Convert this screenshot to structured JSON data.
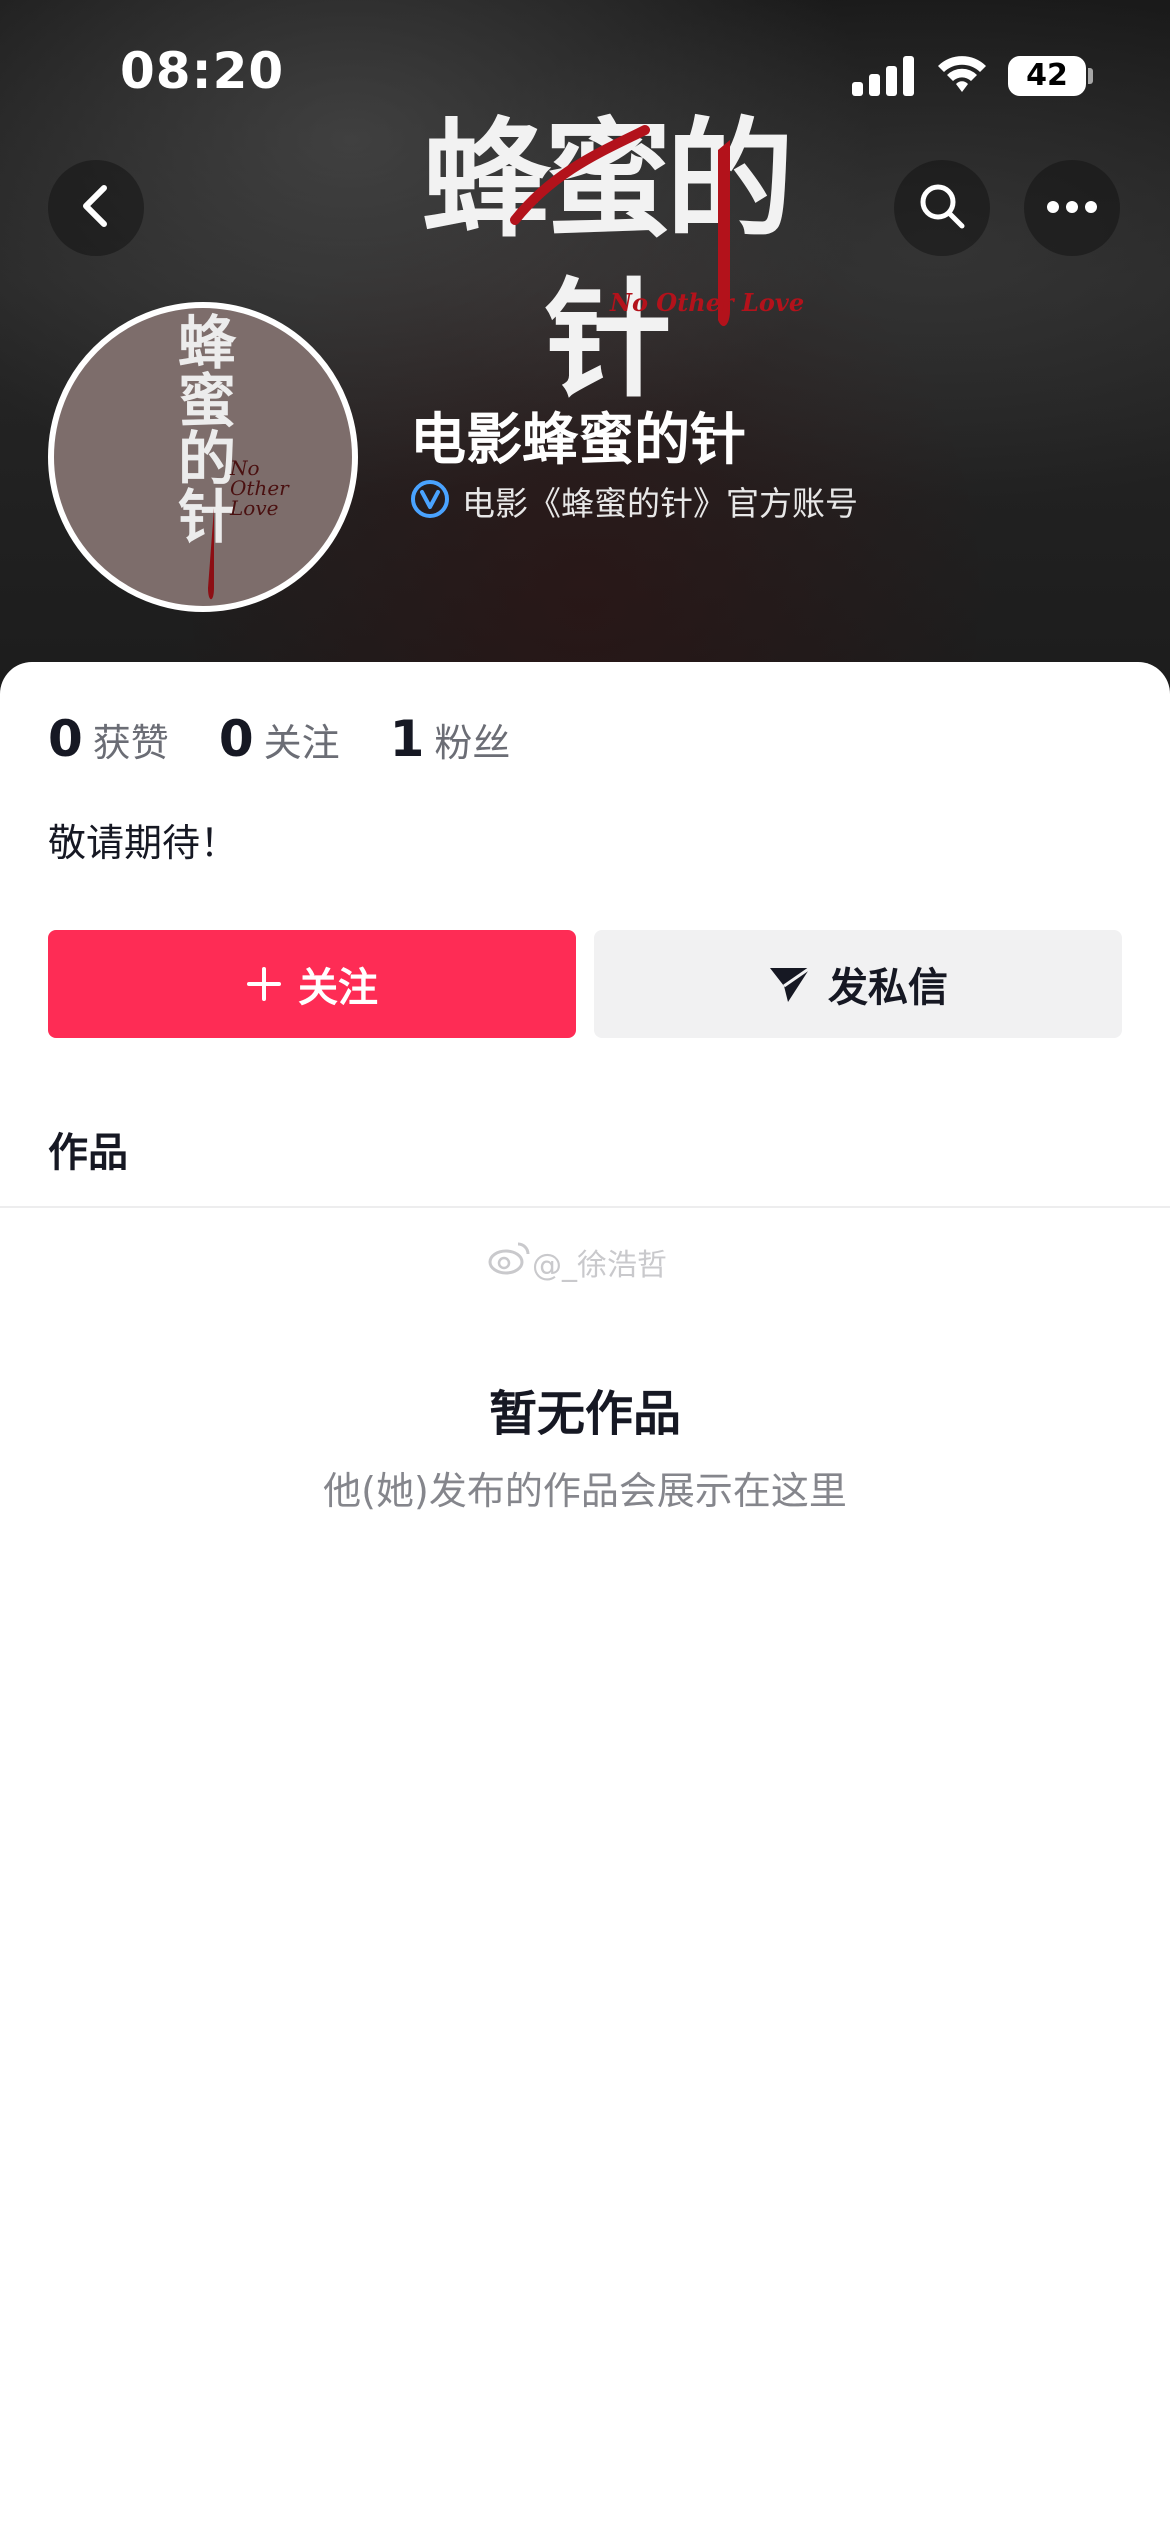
{
  "status_bar": {
    "time": "08:20",
    "battery": "42"
  },
  "banner": {
    "logo_title": "蜂蜜的针",
    "logo_subtitle": "No Other Love"
  },
  "profile": {
    "avatar_title": "蜂蜜的针",
    "avatar_subtitle": "No Other Love",
    "name": "电影蜂蜜的针",
    "verified_text": "电影《蜂蜜的针》官方账号",
    "stats": [
      {
        "value": "0",
        "label": "获赞"
      },
      {
        "value": "0",
        "label": "关注"
      },
      {
        "value": "1",
        "label": "粉丝"
      }
    ],
    "bio": "敬请期待！"
  },
  "actions": {
    "follow_label": "关注",
    "message_label": "发私信"
  },
  "tabs": {
    "works_label": "作品"
  },
  "watermark": "@_徐浩哲",
  "empty_state": {
    "title": "暂无作品",
    "subtitle": "他(她)发布的作品会展示在这里"
  },
  "colors": {
    "accent": "#fe2c55",
    "verified": "#4aa3ff"
  }
}
